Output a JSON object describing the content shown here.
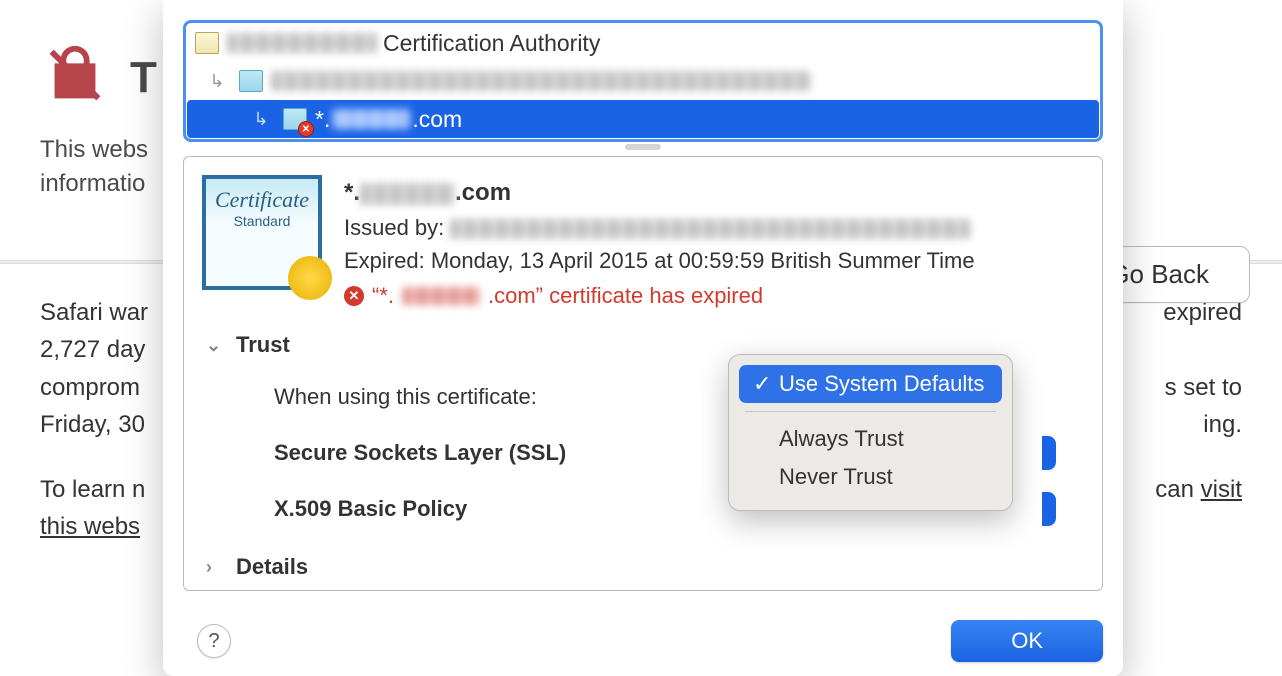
{
  "background": {
    "title_fragment": "T",
    "summary_line1": "This webs",
    "summary_line2": "informatio",
    "go_back_label": "Go Back",
    "details_line1_a": "Safari war",
    "details_line1_b": "expired",
    "details_line2_a": "2,727 day",
    "details_line3_a": "comprom",
    "details_line3_b": "s set to",
    "details_line4_a": "Friday, 30",
    "details_line4_b": "ing.",
    "learn_a": "To learn n",
    "learn_b": "can ",
    "learn_link": "visit",
    "learn_link2": "this webs"
  },
  "chain": {
    "root_suffix": " Certification Authority",
    "leaf_prefix": "*.",
    "leaf_suffix": ".com"
  },
  "detail": {
    "name_prefix": "*.",
    "name_suffix": ".com",
    "issued_label": "Issued by: ",
    "expired_line": "Expired: Monday, 13 April 2015 at 00:59:59 British Summer Time",
    "error_prefix": "“*.",
    "error_suffix": ".com” certificate has expired",
    "cert_script": "Certificate",
    "cert_standard": "Standard"
  },
  "trust": {
    "section_label": "Trust",
    "row1_label": "When using this certificate:",
    "row2_label": "Secure Sockets Layer (SSL)",
    "row3_label": "X.509 Basic Policy",
    "popup": {
      "selected": "Use System Defaults",
      "opt2": "Always Trust",
      "opt3": "Never Trust"
    }
  },
  "details_section_label": "Details",
  "ok_label": "OK"
}
